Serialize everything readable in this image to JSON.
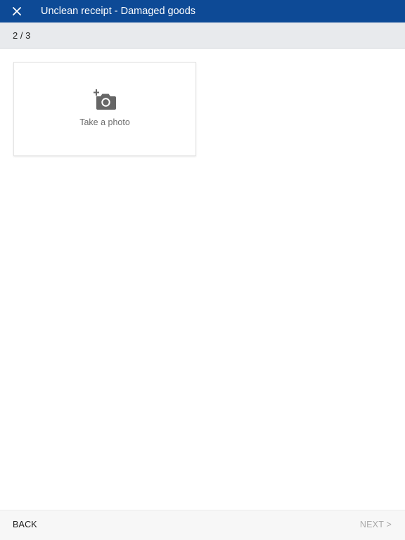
{
  "topbar": {
    "title": "Unclean receipt - Damaged goods",
    "close_icon": "close-icon",
    "background": "#0d4a96"
  },
  "stepper": {
    "text": "2 / 3"
  },
  "photo_card": {
    "icon": "add-photo-camera-icon",
    "label": "Take a photo"
  },
  "footer": {
    "back_label": "BACK",
    "next_label": "NEXT >",
    "next_enabled": false
  }
}
